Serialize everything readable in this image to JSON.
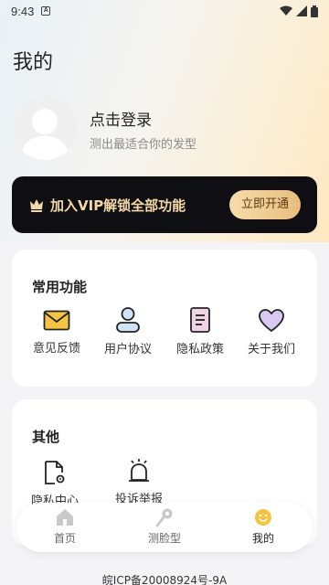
{
  "status_bar": {
    "time": "9:43",
    "notification": "A"
  },
  "header": {
    "title": "我的"
  },
  "profile": {
    "login_label": "点击登录",
    "subtitle": "测出最适合你的发型"
  },
  "vip": {
    "text": "加入VIP解锁全部功能",
    "button_label": "立即开通"
  },
  "common_functions": {
    "title": "常用功能",
    "items": [
      {
        "label": "意见反馈",
        "icon": "mail-icon"
      },
      {
        "label": "用户协议",
        "icon": "user-icon"
      },
      {
        "label": "隐私政策",
        "icon": "document-icon"
      },
      {
        "label": "关于我们",
        "icon": "heart-icon"
      }
    ]
  },
  "other": {
    "title": "其他",
    "items": [
      {
        "label": "隐私中心",
        "icon": "doc-gear-icon"
      },
      {
        "label": "投诉举报",
        "icon": "alarm-icon"
      }
    ]
  },
  "bottom_nav": {
    "items": [
      {
        "label": "首页",
        "icon": "home-icon"
      },
      {
        "label": "测脸型",
        "icon": "face-test-icon"
      },
      {
        "label": "我的",
        "icon": "me-icon"
      }
    ],
    "active_index": 2
  },
  "footer": {
    "icp": "皖ICP备20008924号-9A"
  },
  "colors": {
    "accent": "#f5c542",
    "vip_gold": "#f3d9a8",
    "purple": "#d9c8f2"
  }
}
